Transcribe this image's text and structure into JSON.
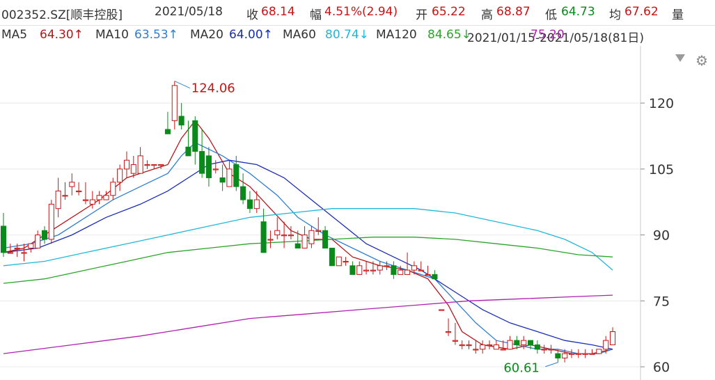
{
  "header": {
    "stock": "002352.SZ[顺丰控股]",
    "date": "2021/05/18",
    "close_label": "收",
    "close": "68.14",
    "change_label": "幅",
    "change": "4.51%(2.94)",
    "open_label": "开",
    "open": "65.22",
    "high_label": "高",
    "high": "68.87",
    "low_label": "低",
    "low": "64.73",
    "avg_label": "均",
    "avg": "67.62",
    "vol_label": "量"
  },
  "ma_bar": {
    "ma5_label": "MA5",
    "ma5": "64.30↑",
    "ma10_label": "MA10",
    "ma10": "63.53↑",
    "ma20_label": "MA20",
    "ma20": "64.00↑",
    "ma60_label": "MA60",
    "ma60": "80.74↓",
    "ma120_label": "MA120",
    "ma120": "84.65↓",
    "overlap_range": "2021/01/15-2021/05/18(81日)",
    "overlap_ma": "75.20"
  },
  "icons": {
    "dropdown": "dropdown-arrow-icon",
    "settings": "gear-icon"
  },
  "colors": {
    "up": "#c81414",
    "down": "#0a8a1a",
    "ma5": "#b8151a",
    "ma10": "#2f7ed1",
    "ma20": "#1a2db5",
    "ma60": "#20b8d8",
    "ma120": "#2aa52a",
    "ma250": "#b020b0"
  },
  "chart_data": {
    "type": "candlestick",
    "ylim": [
      57,
      133
    ],
    "yticks": [
      60,
      75,
      90,
      105,
      120
    ],
    "max_label": "124.06",
    "min_label": "60.61",
    "candles": [
      [
        92,
        95,
        85,
        86
      ],
      [
        86,
        88,
        86,
        86
      ],
      [
        87,
        88,
        85,
        87
      ],
      [
        86,
        88,
        84,
        86
      ],
      [
        87,
        88,
        86,
        88
      ],
      [
        87,
        91,
        87,
        90
      ],
      [
        91,
        92,
        88,
        89
      ],
      [
        89,
        98,
        88,
        97
      ],
      [
        96,
        103,
        94,
        100
      ],
      [
        99,
        102,
        98,
        99
      ],
      [
        101,
        104,
        99,
        102
      ],
      [
        100,
        102,
        99,
        100
      ],
      [
        98,
        102,
        97,
        98
      ],
      [
        97,
        100,
        96,
        98
      ],
      [
        98,
        100,
        97,
        99
      ],
      [
        98,
        100,
        98,
        99
      ],
      [
        99,
        103,
        98,
        102
      ],
      [
        102,
        106,
        100,
        105
      ],
      [
        105,
        109,
        103,
        107
      ],
      [
        104,
        108,
        103,
        106
      ],
      [
        104,
        110,
        104,
        108
      ],
      [
        106,
        107,
        105,
        106
      ],
      [
        106,
        106,
        105,
        106
      ],
      [
        106,
        106,
        105,
        106
      ],
      [
        114,
        118,
        113,
        113
      ],
      [
        116,
        125,
        114,
        124
      ],
      [
        117,
        120,
        114,
        115
      ],
      [
        110,
        116,
        108,
        108
      ],
      [
        116,
        117,
        106,
        109
      ],
      [
        109,
        114,
        103,
        104
      ],
      [
        108,
        110,
        101,
        103
      ],
      [
        105,
        107,
        104,
        105
      ],
      [
        103,
        106,
        100,
        102
      ],
      [
        101,
        107,
        101,
        105
      ],
      [
        106,
        108,
        100,
        101
      ],
      [
        101,
        104,
        97,
        98
      ],
      [
        98,
        100,
        95,
        96
      ],
      [
        96,
        100,
        95,
        98
      ],
      [
        93,
        96,
        86,
        86
      ],
      [
        89,
        91,
        87,
        89
      ],
      [
        90,
        94,
        89,
        91
      ],
      [
        90,
        93,
        87,
        90
      ],
      [
        90,
        92,
        89,
        90
      ],
      [
        88,
        91,
        87,
        87
      ],
      [
        87,
        92,
        87,
        90
      ],
      [
        88,
        92,
        87,
        91
      ],
      [
        91,
        94,
        90,
        91
      ],
      [
        91,
        92,
        87,
        87
      ],
      [
        87,
        87,
        84,
        83
      ],
      [
        83,
        85,
        84,
        85
      ],
      [
        84,
        85,
        83,
        84
      ],
      [
        83,
        84,
        81,
        81
      ],
      [
        81,
        84,
        81,
        83
      ],
      [
        82,
        84,
        81,
        82
      ],
      [
        82,
        84,
        81,
        82
      ],
      [
        82,
        84,
        81,
        83
      ],
      [
        83,
        84,
        82,
        83
      ],
      [
        83,
        84,
        80,
        81
      ],
      [
        81,
        83,
        81,
        82
      ],
      [
        81,
        86,
        81,
        82
      ],
      [
        82,
        84,
        81,
        83
      ],
      [
        82,
        84,
        82,
        82
      ],
      [
        81,
        83,
        81,
        81
      ],
      [
        81,
        82,
        80,
        80
      ],
      [
        73,
        73,
        73,
        73
      ],
      [
        68,
        71,
        67,
        68
      ],
      [
        66,
        70,
        65,
        66
      ],
      [
        65,
        66,
        64,
        65
      ],
      [
        65,
        66,
        64,
        65
      ],
      [
        64,
        66,
        63,
        64
      ],
      [
        64,
        66,
        63,
        65
      ],
      [
        65,
        66,
        64,
        65
      ],
      [
        64,
        66,
        64,
        65
      ],
      [
        64,
        66,
        64,
        64
      ],
      [
        64,
        67,
        64,
        66
      ],
      [
        66,
        67,
        64,
        65
      ],
      [
        65,
        67,
        64,
        66
      ],
      [
        66,
        66,
        64,
        65
      ],
      [
        65,
        66,
        63,
        64
      ],
      [
        64,
        65,
        63,
        64
      ],
      [
        64,
        65,
        63,
        64
      ],
      [
        63,
        64,
        61,
        62
      ],
      [
        62,
        64,
        61,
        63
      ],
      [
        63,
        64,
        62,
        63
      ],
      [
        63,
        64,
        62,
        63
      ],
      [
        63,
        64,
        62,
        63
      ],
      [
        63,
        64,
        63,
        63
      ],
      [
        63,
        64,
        63,
        64
      ],
      [
        64,
        67,
        63,
        66
      ],
      [
        65,
        69,
        65,
        68
      ]
    ],
    "series": [
      {
        "name": "MA5",
        "color_key": "ma5",
        "points": [
          [
            0,
            86
          ],
          [
            3,
            87
          ],
          [
            8,
            92
          ],
          [
            14,
            98
          ],
          [
            18,
            103
          ],
          [
            24,
            106
          ],
          [
            26,
            112
          ],
          [
            28,
            116
          ],
          [
            30,
            112
          ],
          [
            33,
            104
          ],
          [
            36,
            101
          ],
          [
            39,
            96
          ],
          [
            42,
            91
          ],
          [
            45,
            89
          ],
          [
            48,
            89
          ],
          [
            51,
            85
          ],
          [
            55,
            83
          ],
          [
            59,
            82
          ],
          [
            62,
            80
          ],
          [
            65,
            74
          ],
          [
            67,
            68
          ],
          [
            70,
            65
          ],
          [
            74,
            64
          ],
          [
            77,
            65
          ],
          [
            80,
            64
          ],
          [
            83,
            63
          ],
          [
            86,
            63
          ],
          [
            89,
            64
          ]
        ]
      },
      {
        "name": "MA10",
        "color_key": "ma10",
        "points": [
          [
            0,
            87
          ],
          [
            4,
            88
          ],
          [
            8,
            90
          ],
          [
            12,
            94
          ],
          [
            16,
            98
          ],
          [
            20,
            101
          ],
          [
            24,
            104
          ],
          [
            26,
            108
          ],
          [
            28,
            111
          ],
          [
            32,
            108
          ],
          [
            36,
            104
          ],
          [
            40,
            99
          ],
          [
            43,
            94
          ],
          [
            47,
            90
          ],
          [
            51,
            87
          ],
          [
            55,
            84
          ],
          [
            59,
            82
          ],
          [
            63,
            80
          ],
          [
            66,
            75
          ],
          [
            69,
            70
          ],
          [
            72,
            66
          ],
          [
            75,
            65
          ],
          [
            78,
            64
          ],
          [
            81,
            64
          ],
          [
            84,
            63
          ],
          [
            87,
            63
          ],
          [
            89,
            64
          ]
        ]
      },
      {
        "name": "MA20",
        "color_key": "ma20",
        "points": [
          [
            0,
            86
          ],
          [
            5,
            87
          ],
          [
            10,
            90
          ],
          [
            15,
            94
          ],
          [
            20,
            97
          ],
          [
            24,
            100
          ],
          [
            27,
            103
          ],
          [
            30,
            106
          ],
          [
            33,
            107
          ],
          [
            37,
            106
          ],
          [
            41,
            103
          ],
          [
            45,
            98
          ],
          [
            49,
            93
          ],
          [
            53,
            88
          ],
          [
            57,
            85
          ],
          [
            61,
            82
          ],
          [
            64,
            79
          ],
          [
            67,
            76
          ],
          [
            70,
            73
          ],
          [
            74,
            70
          ],
          [
            78,
            68
          ],
          [
            82,
            66
          ],
          [
            86,
            65
          ],
          [
            89,
            64
          ]
        ]
      },
      {
        "name": "MA60",
        "color_key": "ma60",
        "points": [
          [
            0,
            83
          ],
          [
            6,
            84
          ],
          [
            12,
            86
          ],
          [
            18,
            88
          ],
          [
            24,
            90
          ],
          [
            30,
            92
          ],
          [
            36,
            94
          ],
          [
            42,
            95
          ],
          [
            48,
            96
          ],
          [
            54,
            96
          ],
          [
            60,
            96
          ],
          [
            66,
            95
          ],
          [
            72,
            93
          ],
          [
            78,
            91
          ],
          [
            82,
            89
          ],
          [
            86,
            86
          ],
          [
            89,
            82
          ]
        ]
      },
      {
        "name": "MA120",
        "color_key": "ma120",
        "points": [
          [
            0,
            79
          ],
          [
            6,
            80
          ],
          [
            12,
            82
          ],
          [
            18,
            84
          ],
          [
            24,
            86
          ],
          [
            30,
            87
          ],
          [
            36,
            88
          ],
          [
            42,
            88.5
          ],
          [
            48,
            89
          ],
          [
            54,
            89.5
          ],
          [
            60,
            89.5
          ],
          [
            66,
            89
          ],
          [
            72,
            88
          ],
          [
            78,
            87
          ],
          [
            84,
            85.5
          ],
          [
            89,
            85
          ]
        ]
      },
      {
        "name": "MA250",
        "color_key": "ma250",
        "points": [
          [
            0,
            63
          ],
          [
            10,
            65
          ],
          [
            20,
            67
          ],
          [
            28,
            69
          ],
          [
            36,
            71
          ],
          [
            44,
            72
          ],
          [
            52,
            73
          ],
          [
            60,
            74
          ],
          [
            68,
            75
          ],
          [
            76,
            75.5
          ],
          [
            84,
            76
          ],
          [
            89,
            76.3
          ]
        ]
      }
    ]
  }
}
